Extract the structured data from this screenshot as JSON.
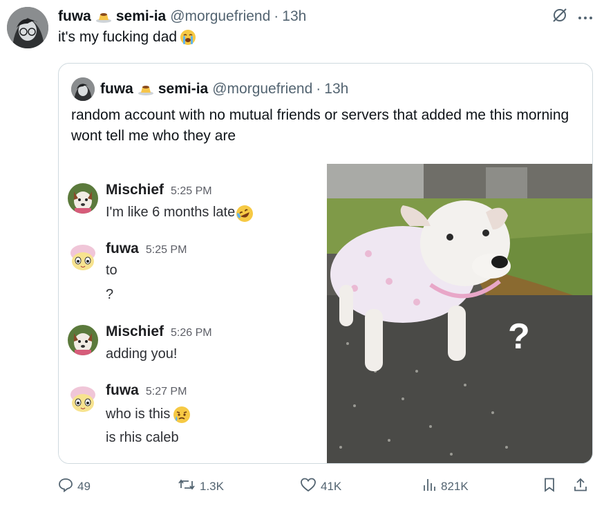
{
  "tweet": {
    "display_name": "fuwa",
    "name_emoji": "custard-pudding-emoji",
    "name_suffix": "semi-ia",
    "handle": "@morguefriend",
    "separator": "·",
    "time": "13h",
    "text": "it's my fucking dad",
    "text_emoji": "loudly-crying-face-emoji"
  },
  "quote": {
    "display_name": "fuwa",
    "name_suffix": "semi-ia",
    "handle": "@morguefriend",
    "separator": "·",
    "time": "13h",
    "text": "random account with no mutual friends or servers that added me this morning wont tell me who they are"
  },
  "chat": {
    "messages": [
      {
        "author": "Mischief",
        "time": "5:25 PM",
        "lines": [
          "I'm like 6 months late"
        ]
      },
      {
        "author": "fuwa",
        "time": "5:25 PM",
        "lines": [
          "to",
          "?"
        ]
      },
      {
        "author": "Mischief",
        "time": "5:26 PM",
        "lines": [
          "adding you!"
        ]
      },
      {
        "author": "fuwa",
        "time": "5:27 PM",
        "lines": [
          "who is this",
          "is rhis caleb"
        ]
      }
    ]
  },
  "photo": {
    "overlay_text": "?"
  },
  "actions": {
    "replies": "49",
    "reposts": "1.3K",
    "likes": "41K",
    "views": "821K"
  }
}
